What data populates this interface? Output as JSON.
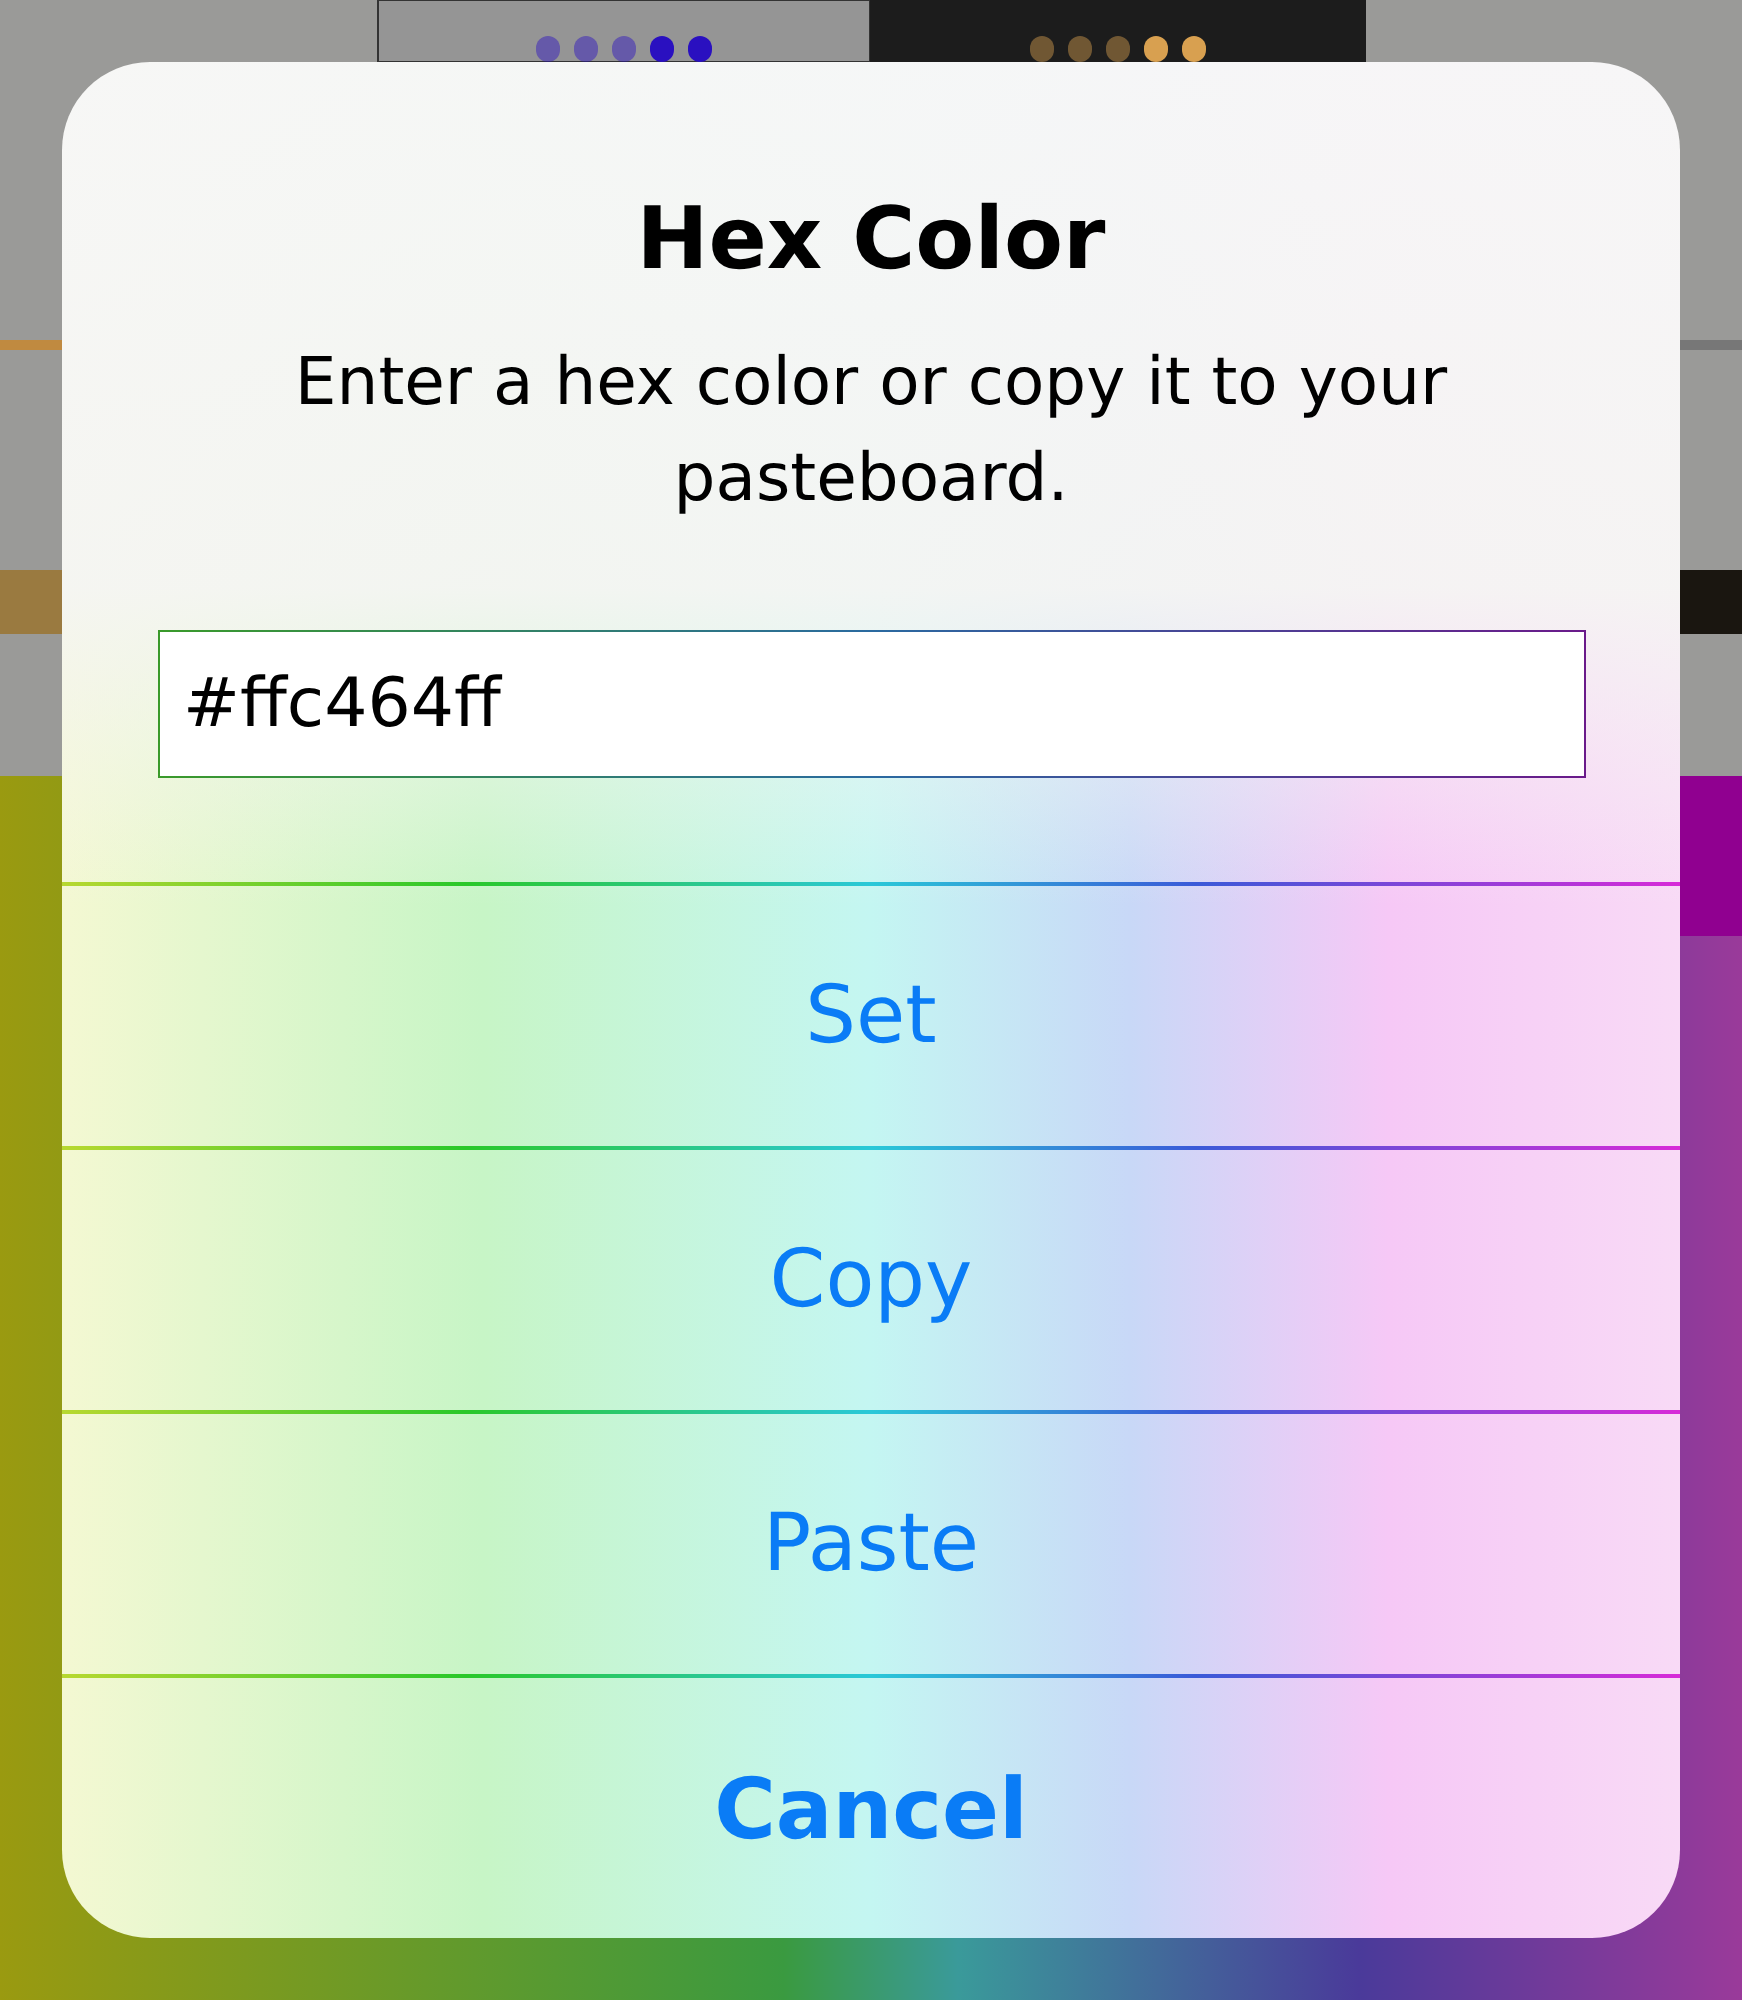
{
  "alert": {
    "title": "Hex Color",
    "message": "Enter a hex color or copy it to your pasteboard.",
    "field": {
      "value": "#ffc464ff"
    },
    "actions": [
      {
        "label": "Set",
        "kind": "default"
      },
      {
        "label": "Copy",
        "kind": "default"
      },
      {
        "label": "Paste",
        "kind": "default"
      },
      {
        "label": "Cancel",
        "kind": "cancel"
      }
    ]
  }
}
